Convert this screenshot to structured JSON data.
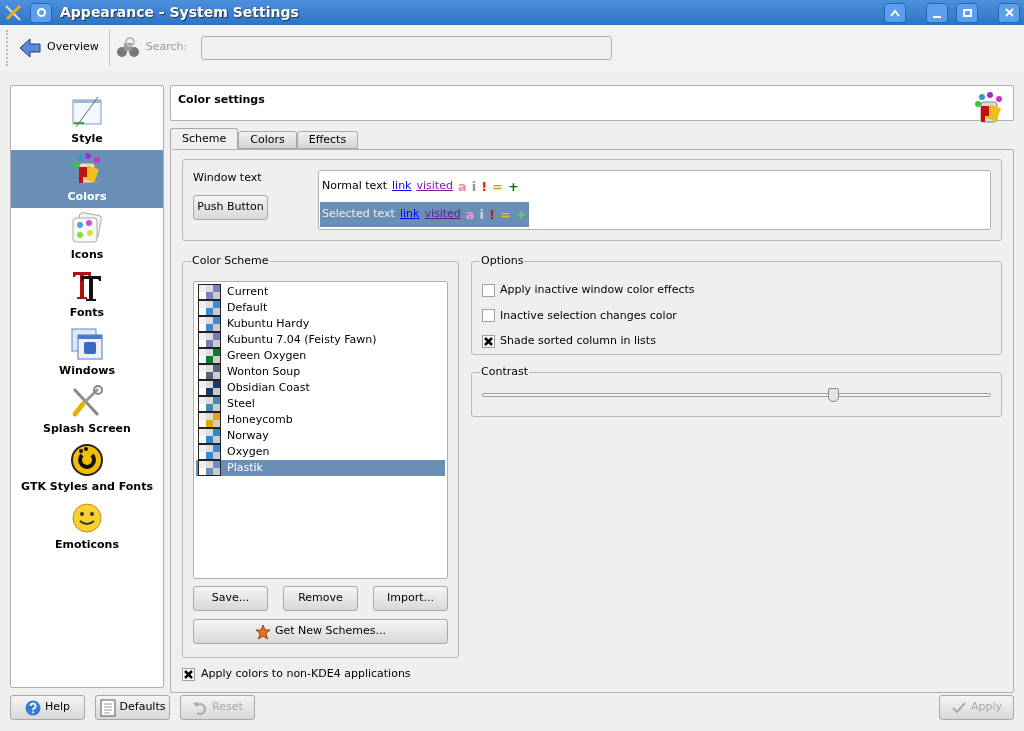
{
  "window": {
    "title": "Appearance - System Settings"
  },
  "toolbar": {
    "overview": "Overview",
    "search_label": "Search:"
  },
  "sidebar": {
    "items": [
      {
        "label": "Style",
        "kind": "style",
        "selected": false
      },
      {
        "label": "Colors",
        "kind": "colors",
        "selected": true
      },
      {
        "label": "Icons",
        "kind": "icons",
        "selected": false
      },
      {
        "label": "Fonts",
        "kind": "fonts",
        "selected": false
      },
      {
        "label": "Windows",
        "kind": "windows",
        "selected": false
      },
      {
        "label": "Splash Screen",
        "kind": "splash",
        "selected": false
      },
      {
        "label": "GTK Styles and Fonts",
        "kind": "gtk",
        "selected": false
      },
      {
        "label": "Emoticons",
        "kind": "emoticons",
        "selected": false
      }
    ]
  },
  "header": {
    "title": "Color settings"
  },
  "tabs": [
    {
      "label": "Scheme",
      "selected": true
    },
    {
      "label": "Colors",
      "selected": false
    },
    {
      "label": "Effects",
      "selected": false
    }
  ],
  "preview": {
    "label": "Window text",
    "button": "Push Button",
    "rows": [
      {
        "selected": false,
        "tokens": [
          {
            "text": "Normal text",
            "kind": "plain",
            "color": "#000000"
          },
          {
            "text": "link",
            "kind": "link",
            "color": "#0000ff"
          },
          {
            "text": "visited",
            "kind": "link",
            "color": "#7a1f9f"
          },
          {
            "text": "a",
            "kind": "plain",
            "color": "#ff80c0"
          },
          {
            "text": "i",
            "kind": "plain",
            "color": "#909090"
          },
          {
            "text": "!",
            "kind": "plain",
            "color": "#e02020"
          },
          {
            "text": "=",
            "kind": "plain",
            "color": "#d0a000"
          },
          {
            "text": "+",
            "kind": "plain",
            "color": "#107010"
          }
        ]
      },
      {
        "selected": true,
        "tokens": [
          {
            "text": "Selected text",
            "kind": "plain",
            "color": "#f0f0f0"
          },
          {
            "text": "link",
            "kind": "link",
            "color": "#0000ff"
          },
          {
            "text": "visited",
            "kind": "link",
            "color": "#5a1f8f"
          },
          {
            "text": "a",
            "kind": "plain",
            "color": "#ff90d0"
          },
          {
            "text": "i",
            "kind": "plain",
            "color": "#c8d4e4"
          },
          {
            "text": "!",
            "kind": "plain",
            "color": "#b02020"
          },
          {
            "text": "=",
            "kind": "plain",
            "color": "#e0c000"
          },
          {
            "text": "+",
            "kind": "plain",
            "color": "#60e060"
          }
        ]
      }
    ]
  },
  "color_scheme": {
    "title": "Color Scheme",
    "items": [
      {
        "name": "Current",
        "color": "#7c7fc0",
        "selected": false
      },
      {
        "name": "Default",
        "color": "#3c8ad8",
        "selected": false
      },
      {
        "name": "Kubuntu Hardy",
        "color": "#4a86d8",
        "selected": false
      },
      {
        "name": "Kubuntu 7.04 (Feisty Fawn)",
        "color": "#7a7ab8",
        "selected": false
      },
      {
        "name": "Green Oxygen",
        "color": "#0a7a30",
        "selected": false
      },
      {
        "name": "Wonton Soup",
        "color": "#5a6478",
        "selected": false
      },
      {
        "name": "Obsidian Coast",
        "color": "#1a3a6a",
        "selected": false
      },
      {
        "name": "Steel",
        "color": "#4a8aa8",
        "selected": false
      },
      {
        "name": "Honeycomb",
        "color": "#e0a800",
        "selected": false
      },
      {
        "name": "Norway",
        "color": "#2a88d0",
        "selected": false
      },
      {
        "name": "Oxygen",
        "color": "#3a88d8",
        "selected": false
      },
      {
        "name": "Plastik",
        "color": "#6a90c0",
        "selected": true
      }
    ],
    "buttons": [
      "Save...",
      "Remove",
      "Import..."
    ],
    "get_new": "Get New Schemes..."
  },
  "options": {
    "title": "Options",
    "items": [
      {
        "label": "Apply inactive window color effects",
        "checked": false
      },
      {
        "label": "Inactive selection changes color",
        "checked": false
      },
      {
        "label": "Shade sorted column in lists",
        "checked": true
      }
    ]
  },
  "contrast": {
    "title": "Contrast",
    "level": 0.69
  },
  "apply_non_kde": {
    "label": "Apply colors to non-KDE4 applications",
    "checked": true
  },
  "footer": [
    {
      "label": "Help",
      "kind": "help",
      "disabled": false
    },
    {
      "label": "Defaults",
      "kind": "defaults",
      "disabled": false
    },
    {
      "label": "Reset",
      "kind": "reset",
      "disabled": true
    },
    {
      "label": "Apply",
      "kind": "apply",
      "disabled": true
    }
  ]
}
